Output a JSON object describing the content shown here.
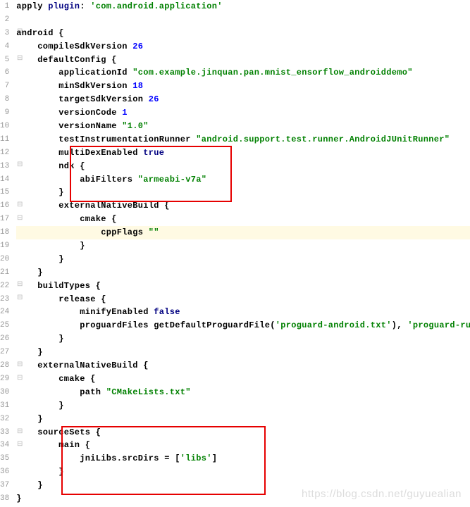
{
  "gutter": {
    "lines": [
      "1",
      "2",
      "3",
      "4",
      "5",
      "6",
      "7",
      "8",
      "9",
      "10",
      "11",
      "12",
      "13",
      "14",
      "15",
      "16",
      "17",
      "18",
      "19",
      "20",
      "21",
      "22",
      "23",
      "24",
      "25",
      "26",
      "27",
      "28",
      "29",
      "30",
      "31",
      "32",
      "33",
      "34",
      "35",
      "36",
      "37",
      "38"
    ]
  },
  "code": {
    "l1": {
      "a": "apply ",
      "b": "plugin",
      "c": ": ",
      "d": "'com.android.application'"
    },
    "l3": {
      "a": "android {"
    },
    "l4": {
      "a": "    compileSdkVersion ",
      "b": "26"
    },
    "l5": {
      "a": "    defaultConfig {"
    },
    "l6": {
      "a": "        applicationId ",
      "b": "\"com.example.jinquan.pan.mnist_ensorflow_androiddemo\""
    },
    "l7": {
      "a": "        minSdkVersion ",
      "b": "18"
    },
    "l8": {
      "a": "        targetSdkVersion ",
      "b": "26"
    },
    "l9": {
      "a": "        versionCode ",
      "b": "1"
    },
    "l10": {
      "a": "        versionName ",
      "b": "\"1.0\""
    },
    "l11": {
      "a": "        testInstrumentationRunner ",
      "b": "\"android.support.test.runner.AndroidJUnitRunner\""
    },
    "l12": {
      "a": "        multiDexEnabled ",
      "b": "true"
    },
    "l13": {
      "a": "        ndk {"
    },
    "l14": {
      "a": "            abiFilters ",
      "b": "\"armeabi-v7a\""
    },
    "l15": {
      "a": "        }"
    },
    "l16": {
      "a": "        externalNativeBuild {"
    },
    "l17": {
      "a": "            cmake {"
    },
    "l18": {
      "a": "                cppFlags ",
      "b": "\"\""
    },
    "l19": {
      "a": "            }"
    },
    "l20": {
      "a": "        }"
    },
    "l21": {
      "a": "    }"
    },
    "l22": {
      "a": "    buildTypes {"
    },
    "l23": {
      "a": "        release {"
    },
    "l24": {
      "a": "            minifyEnabled ",
      "b": "false"
    },
    "l25": {
      "a": "            proguardFiles ",
      "b": "getDefaultProguardFile(",
      "c": "'proguard-android.txt'",
      "d": "), ",
      "e": "'proguard-rules.pro'"
    },
    "l26": {
      "a": "        }"
    },
    "l27": {
      "a": "    }"
    },
    "l28": {
      "a": "    externalNativeBuild {"
    },
    "l29": {
      "a": "        cmake {"
    },
    "l30": {
      "a": "            path ",
      "b": "\"CMakeLists.txt\""
    },
    "l31": {
      "a": "        }"
    },
    "l32": {
      "a": "    }"
    },
    "l33": {
      "a": "    sourceSets {"
    },
    "l34": {
      "a": "        main {"
    },
    "l35": {
      "a": "            jniLibs.srcDirs = [",
      "b": "'libs'",
      "c": "]"
    },
    "l36": {
      "a": "        }"
    },
    "l37": {
      "a": "    }"
    },
    "l38": {
      "a": "}"
    }
  },
  "watermark": "https://blog.csdn.net/guyuealian",
  "icons": {
    "bulb": "💡",
    "fold_open": "⊟",
    "fold_start": "⊟",
    "fold_end": "⌐"
  }
}
